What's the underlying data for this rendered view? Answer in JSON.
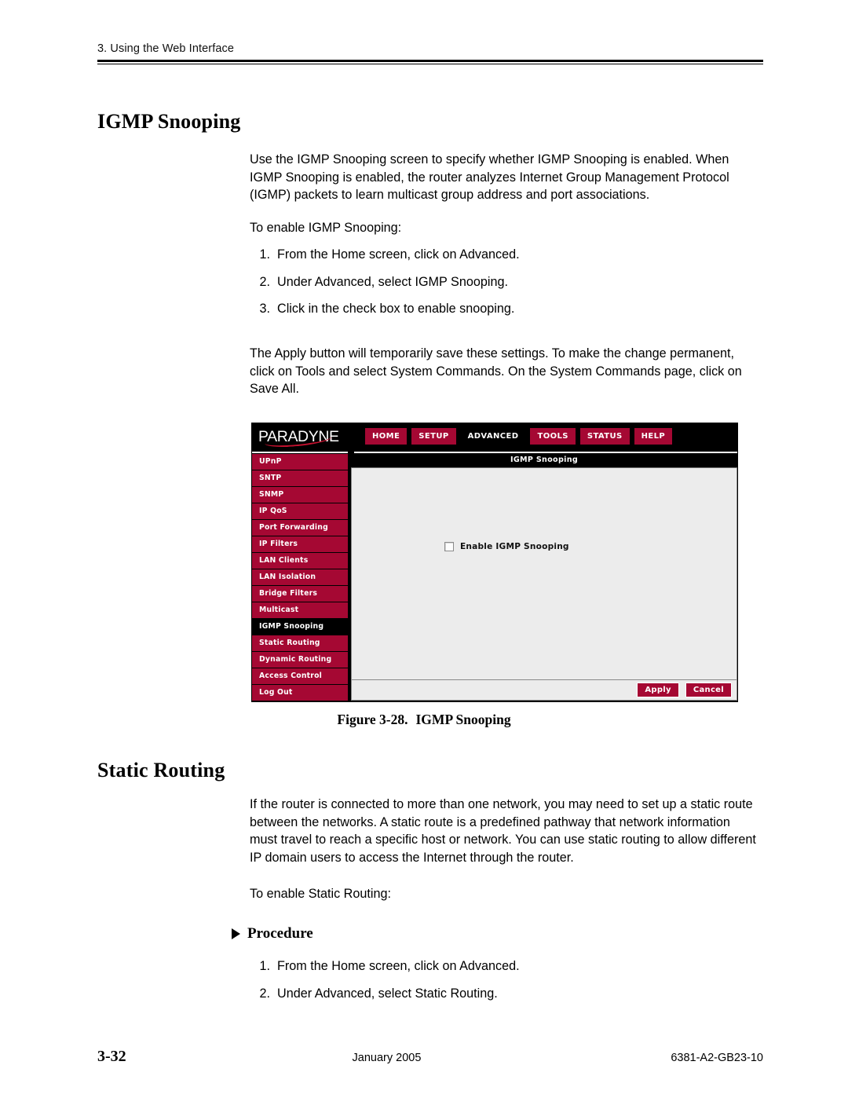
{
  "header": {
    "running_head": "3. Using the Web Interface"
  },
  "sections": {
    "igmp": {
      "heading": "IGMP Snooping",
      "intro": "Use the IGMP Snooping screen to specify whether IGMP Snooping is enabled. When IGMP Snooping is enabled, the router analyzes Internet Group Management Protocol (IGMP) packets to learn multicast group address and port associations.",
      "lead_in": "To enable IGMP Snooping:",
      "steps": [
        {
          "num": "1.",
          "text": "From the Home screen, click on Advanced."
        },
        {
          "num": "2.",
          "text": "Under Advanced, select IGMP Snooping."
        },
        {
          "num": "3.",
          "text": "Click in the check box to enable snooping."
        }
      ],
      "note": "The Apply button will temporarily save these settings. To make the change permanent, click on Tools and select System Commands. On the System Commands page, click on Save All."
    },
    "static_routing": {
      "heading": "Static Routing",
      "intro": "If the router is connected to more than one network, you may need to set up a static route between the networks. A static route is a predefined pathway that network information must travel to reach a specific host or network. You can use static routing to allow different IP domain users to access the Internet through the router.",
      "lead_in": "To enable Static Routing:",
      "procedure_label": "Procedure",
      "steps": [
        {
          "num": "1.",
          "text": "From the Home screen, click on Advanced."
        },
        {
          "num": "2.",
          "text": "Under Advanced, select Static Routing."
        }
      ]
    }
  },
  "figure": {
    "caption_number": "Figure 3-28.",
    "caption_title": "IGMP Snooping",
    "router_ui": {
      "brand": "PARADYNE",
      "nav": [
        {
          "label": "HOME",
          "active": false
        },
        {
          "label": "SETUP",
          "active": false
        },
        {
          "label": "ADVANCED",
          "active": true
        },
        {
          "label": "TOOLS",
          "active": false
        },
        {
          "label": "STATUS",
          "active": false
        },
        {
          "label": "HELP",
          "active": false
        }
      ],
      "sidebar": [
        {
          "label": "UPnP",
          "active": false
        },
        {
          "label": "SNTP",
          "active": false
        },
        {
          "label": "SNMP",
          "active": false
        },
        {
          "label": "IP QoS",
          "active": false
        },
        {
          "label": "Port Forwarding",
          "active": false
        },
        {
          "label": "IP Filters",
          "active": false
        },
        {
          "label": "LAN Clients",
          "active": false
        },
        {
          "label": "LAN Isolation",
          "active": false
        },
        {
          "label": "Bridge Filters",
          "active": false
        },
        {
          "label": "Multicast",
          "active": false
        },
        {
          "label": "IGMP Snooping",
          "active": true
        },
        {
          "label": "Static Routing",
          "active": false
        },
        {
          "label": "Dynamic Routing",
          "active": false
        },
        {
          "label": "Access Control",
          "active": false
        },
        {
          "label": "Log Out",
          "active": false
        }
      ],
      "panel_title": "IGMP Snooping",
      "checkbox_label": "Enable IGMP Snooping",
      "checkbox_checked": false,
      "buttons": [
        {
          "label": "Apply"
        },
        {
          "label": "Cancel"
        }
      ],
      "colors": {
        "brand_red": "#a50833",
        "logo_accent": "#c4112f",
        "chrome_black": "#000000",
        "panel_gray": "#ececec"
      }
    }
  },
  "footer": {
    "page_number": "3-32",
    "date": "January 2005",
    "doc_number": "6381-A2-GB23-10"
  }
}
